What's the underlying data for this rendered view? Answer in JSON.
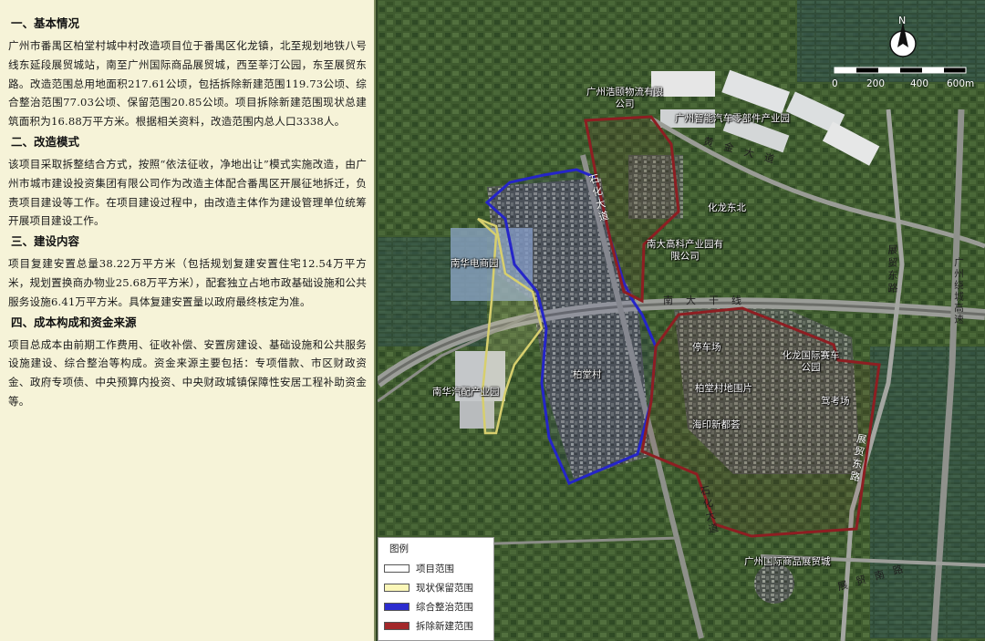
{
  "sections": [
    {
      "title": "一、基本情况",
      "body": "广州市番禺区柏堂村城中村改造项目位于番禺区化龙镇，北至规划地铁八号线东延段展贸城站，南至广州国际商品展贸城，西至莘汀公园，东至展贸东路。改造范围总用地面积217.61公顷，包括拆除新建范围119.73公顷、综合整治范围77.03公顷、保留范围20.85公顷。项目拆除新建范围现状总建筑面积为16.88万平方米。根据相关资料，改造范围内总人口3338人。"
    },
    {
      "title": "二、改造模式",
      "body": "该项目采取拆整结合方式，按照“依法征收，净地出让”模式实施改造，由广州市城市建设投资集团有限公司作为改造主体配合番禺区开展征地拆迁，负责项目建设等工作。在项目建设过程中，由改造主体作为建设管理单位统筹开展项目建设工作。"
    },
    {
      "title": "三、建设内容",
      "body": "项目复建安置总量38.22万平方米（包括规划复建安置住宅12.54万平方米，规划置换商办物业25.68万平方米），配套独立占地市政基础设施和公共服务设施6.41万平方米。具体复建安置量以政府最终核定为准。"
    },
    {
      "title": "四、成本构成和资金来源",
      "body": "项目总成本由前期工作费用、征收补偿、安置房建设、基础设施和公共服务设施建设、综合整治等构成。资金来源主要包括：专项借款、市区财政资金、政府专项债、中央预算内投资、中央财政城镇保障性安居工程补助资金等。"
    }
  ],
  "map": {
    "place_labels": {
      "logistics": "广州浩颐物流有限公司",
      "auto_parts": "广州智能汽车零部件产业园",
      "huajie": "化龙东北",
      "nandagaoke": "南大高科产业园有限公司",
      "ecommerce": "南华电商园",
      "parking": "停车场",
      "racing_park": "化龙国际赛车公园",
      "baitang_plot": "柏堂村地围片",
      "exam_field": "驾考场",
      "baitang": "柏堂村",
      "haiyin": "海印新都荟",
      "auto_accessory": "南华汽配产业园",
      "expo_city": "广州国际商品展贸城"
    },
    "road_labels": {
      "huangjin": "黄金大道",
      "nanda": "南大干线",
      "shihua_north": "石化大道",
      "shihua_south": "石化大道",
      "zhanmao_east_north": "展贸东路",
      "zhanmao_east_south": "展贸东路",
      "zhanmao_south": "展贸南路",
      "guangzhou_ring": "广州绕城高速"
    },
    "scale": {
      "ticks": [
        "0",
        "200",
        "400",
        "600m"
      ]
    },
    "north_label": "N",
    "legend": {
      "title": "图例",
      "items": [
        {
          "label": "项目范围",
          "color": "#ffffff"
        },
        {
          "label": "现状保留范围",
          "color": "#fbf7b8"
        },
        {
          "label": "综合整治范围",
          "color": "#2c2ccf"
        },
        {
          "label": "拆除新建范围",
          "color": "#a3282a"
        }
      ]
    },
    "colors": {
      "retain": "#c9c06a",
      "renovate": "#2323c8",
      "demolish": "#8e1e22",
      "vegetation": "#3c5a2c"
    }
  }
}
